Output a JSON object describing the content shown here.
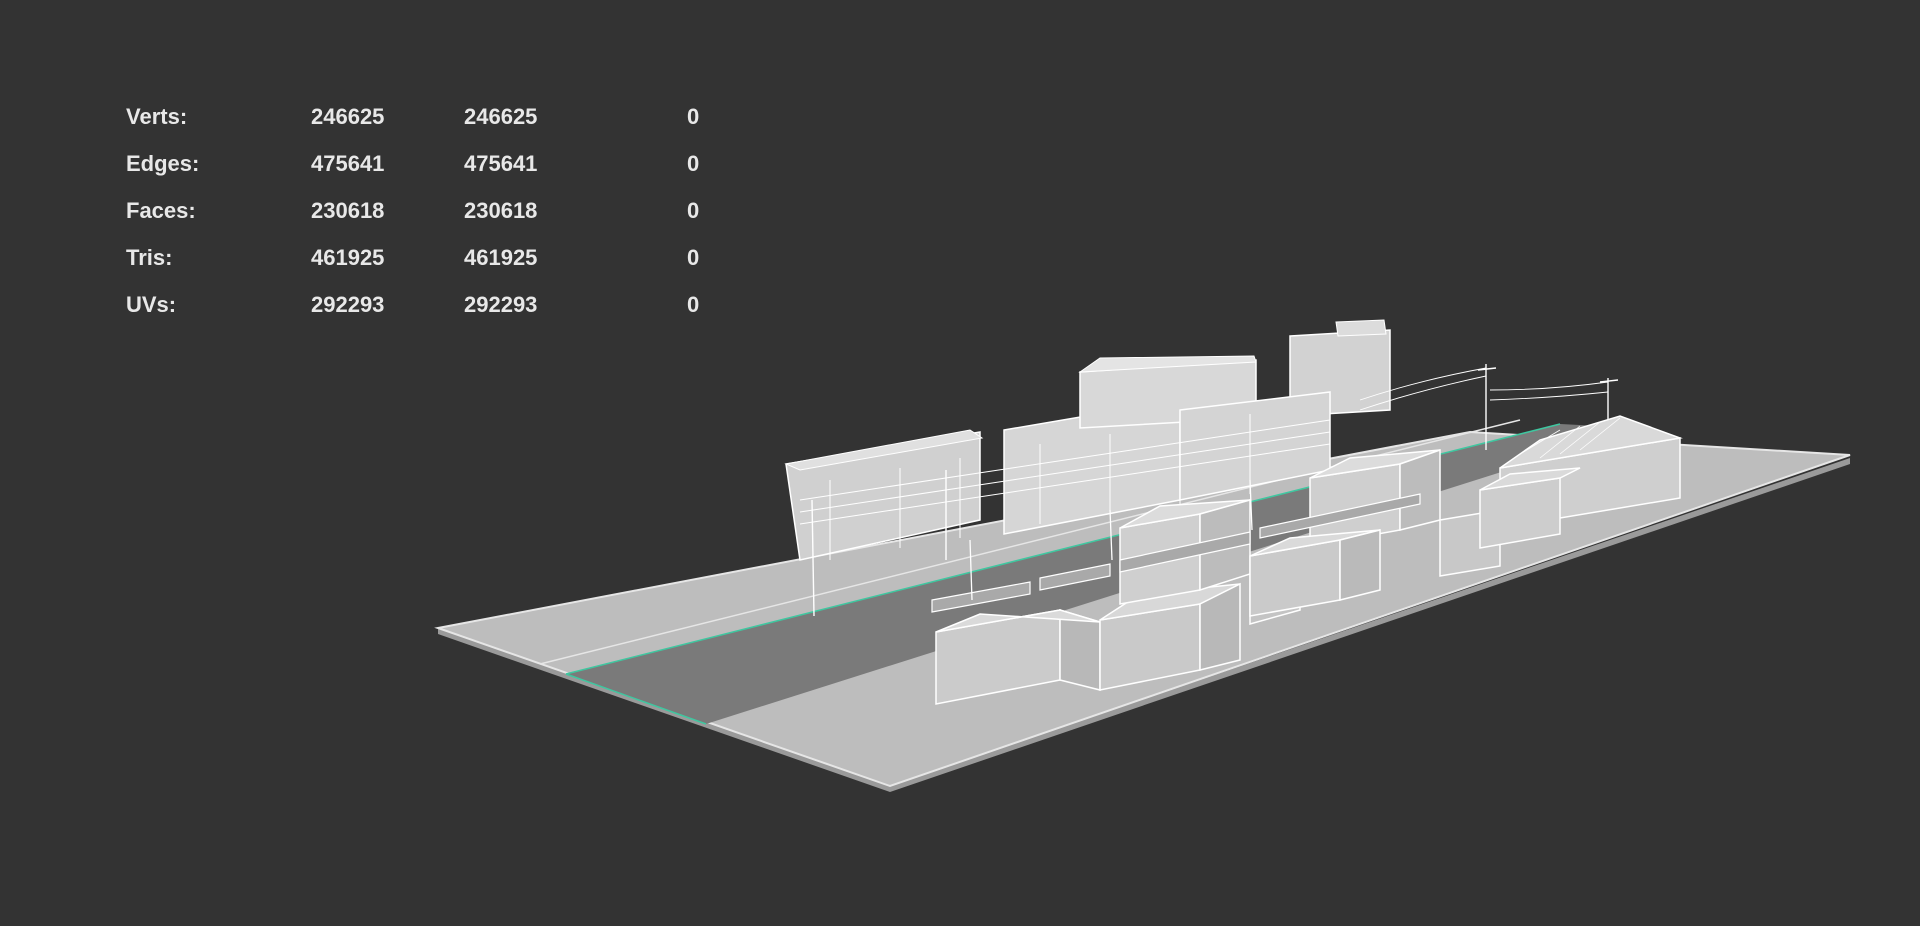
{
  "hud": {
    "rows": [
      {
        "label": "Verts:",
        "total": "246625",
        "visible": "246625",
        "selected": "0"
      },
      {
        "label": "Edges:",
        "total": "475641",
        "visible": "475641",
        "selected": "0"
      },
      {
        "label": "Faces:",
        "total": "230618",
        "visible": "230618",
        "selected": "0"
      },
      {
        "label": "Tris:",
        "total": "461925",
        "visible": "461925",
        "selected": "0"
      },
      {
        "label": "UVs:",
        "total": "292293",
        "visible": "292293",
        "selected": "0"
      }
    ]
  },
  "colors": {
    "background": "#333333",
    "ground": "#bdbdbd",
    "road": "#7a7a7a",
    "wire": "#f5f5f5",
    "selection_edge": "#3fc7a0"
  }
}
